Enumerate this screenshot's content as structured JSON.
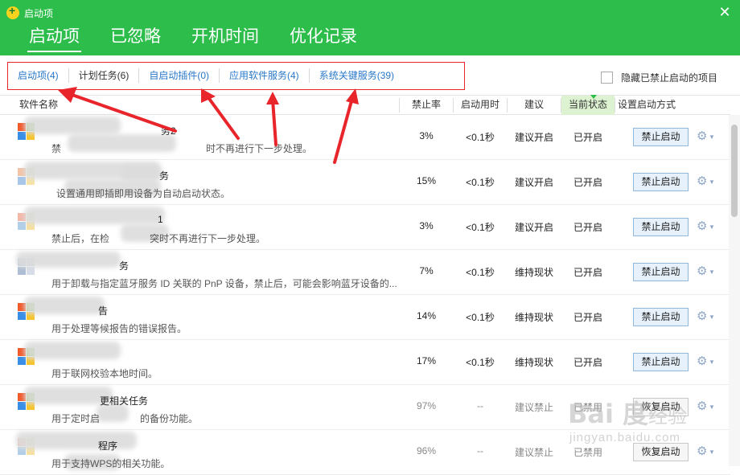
{
  "window": {
    "title": "启动项",
    "close_icon": "close-icon"
  },
  "main_tabs": [
    {
      "label": "启动项",
      "active": true
    },
    {
      "label": "已忽略",
      "active": false
    },
    {
      "label": "开机时间",
      "active": false
    },
    {
      "label": "优化记录",
      "active": false
    }
  ],
  "sub_tabs": [
    {
      "label": "启动项(4)"
    },
    {
      "label": "计划任务(6)"
    },
    {
      "label": "自启动插件(0)"
    },
    {
      "label": "应用软件服务(4)"
    },
    {
      "label": "系统关键服务(39)"
    }
  ],
  "hide_disabled": {
    "label": "隐藏已禁止启动的项目",
    "checked": false
  },
  "columns": {
    "name": "软件名称",
    "disable_rate": "禁止率",
    "startup_time": "启动用时",
    "advice": "建议",
    "current_state": "当前状态",
    "setting": "设置启动方式"
  },
  "rows": [
    {
      "name": "务2",
      "desc": "禁",
      "desc_tail": "时不再进行下一步处理。",
      "rate": "3%",
      "time": "<0.1秒",
      "advice": "建议开启",
      "state": "已开启",
      "action": "禁止启动",
      "disabled": false
    },
    {
      "name": "务",
      "desc": "",
      "desc_tail": "设置通用即插即用设备为自动启动状态。",
      "rate": "15%",
      "time": "<0.1秒",
      "advice": "建议开启",
      "state": "已开启",
      "action": "禁止启动",
      "disabled": false
    },
    {
      "name": "1",
      "desc": "禁止后，在检",
      "desc_tail": "突时不再进行下一步处理。",
      "rate": "3%",
      "time": "<0.1秒",
      "advice": "建议开启",
      "state": "已开启",
      "action": "禁止启动",
      "disabled": false
    },
    {
      "name": "务",
      "desc": "用于卸载与指定蓝牙服务 ID 关联的 PnP 设备，禁止后，可能会影响蓝牙设备的...",
      "desc_tail": "",
      "rate": "7%",
      "time": "<0.1秒",
      "advice": "维持现状",
      "state": "已开启",
      "action": "禁止启动",
      "disabled": false
    },
    {
      "name": "告",
      "desc": "用于处理等候报告的错误报告。",
      "desc_tail": "",
      "rate": "14%",
      "time": "<0.1秒",
      "advice": "维持现状",
      "state": "已开启",
      "action": "禁止启动",
      "disabled": false
    },
    {
      "name": "",
      "desc": "用于联网校验本地时间。",
      "desc_tail": "",
      "rate": "17%",
      "time": "<0.1秒",
      "advice": "维持现状",
      "state": "已开启",
      "action": "禁止启动",
      "disabled": false
    },
    {
      "name": "更相关任务",
      "desc": "用于定时启",
      "desc_tail": "的备份功能。",
      "rate": "97%",
      "time": "--",
      "advice": "建议禁止",
      "state": "已禁用",
      "action": "恢复启动",
      "disabled": true
    },
    {
      "name": "程序",
      "desc": "用于支持WPS的相关功能。",
      "desc_tail": "",
      "rate": "96%",
      "time": "--",
      "advice": "建议禁止",
      "state": "已禁用",
      "action": "恢复启动",
      "disabled": true
    }
  ],
  "icons": {
    "gear": "gear-icon",
    "caret": "caret-down-icon",
    "app": "windows-flag-icon"
  },
  "colors": {
    "header": "#2cbd4b",
    "link": "#2a78c8",
    "annotation": "#e8252b"
  },
  "watermark": {
    "logo": "Bai 度",
    "cn": "经验",
    "url": "jingyan.baidu.com"
  }
}
